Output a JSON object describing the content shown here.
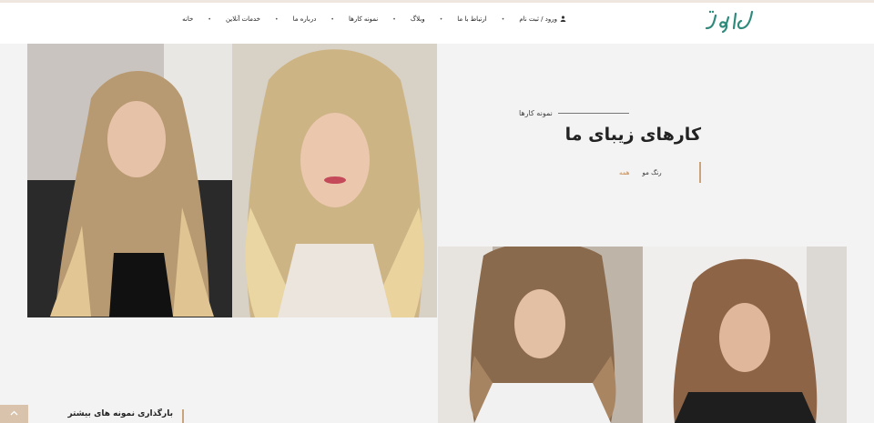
{
  "header": {
    "logo_text": "اشرفیه",
    "nav": [
      {
        "label": "خانه"
      },
      {
        "label": "خدمات آنلاین"
      },
      {
        "label": "درباره ما"
      },
      {
        "label": "نمونه کارها"
      },
      {
        "label": "وبلاگ"
      },
      {
        "label": "ارتباط با ما"
      },
      {
        "label": "ورود / ثبت نام",
        "icon": "user-icon"
      }
    ]
  },
  "portfolio": {
    "subtitle": "نمونه کارها",
    "title": "کارهای زیبای ما",
    "filters": [
      {
        "label": "همه",
        "active": true
      },
      {
        "label": "رنگ مو",
        "active": false
      }
    ],
    "load_more_label": "بارگذاری نمونه های بیشتر"
  },
  "colors": {
    "accent": "#c9a47a",
    "logo": "#2f8a7c",
    "background": "#f3f3f3"
  },
  "icons": {
    "scroll_top": "chevron-up-icon"
  }
}
